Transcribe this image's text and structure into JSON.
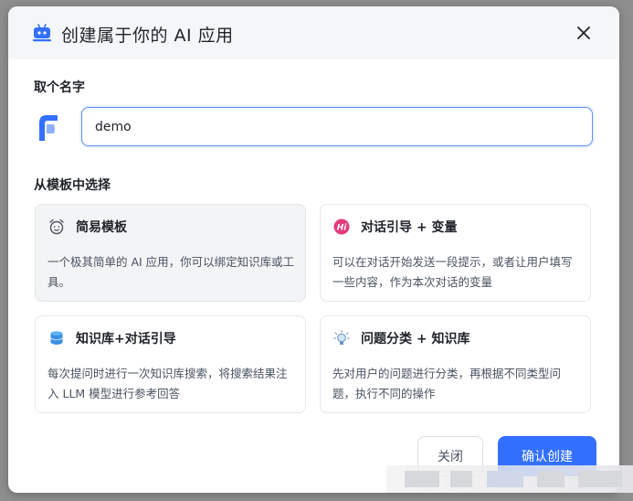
{
  "dialog": {
    "title": "创建属于你的 AI 应用",
    "name_section_label": "取个名字",
    "name_input_value": "demo",
    "template_section_label": "从模板中选择",
    "templates": [
      {
        "icon": "alarm-clock-icon",
        "title": "简易模板",
        "desc": "一个极其简单的 AI 应用，你可以绑定知识库或工具。",
        "selected": true
      },
      {
        "icon": "hi-badge-icon",
        "title": "对话引导 + 变量",
        "desc": "可以在对话开始发送一段提示，或者让用户填写一些内容，作为本次对话的变量",
        "selected": false
      },
      {
        "icon": "database-icon",
        "title": "知识库+对话引导",
        "desc": "每次提问时进行一次知识库搜索，将搜索结果注入 LLM 模型进行参考回答",
        "selected": false
      },
      {
        "icon": "lightbulb-icon",
        "title": "问题分类 + 知识库",
        "desc": "先对用户的问题进行分类，再根据不同类型问题，执行不同的操作",
        "selected": false
      }
    ],
    "cancel_label": "关闭",
    "confirm_label": "确认创建"
  },
  "colors": {
    "accent": "#3370ff",
    "header_bg": "#f5f6f8",
    "selected_card_bg": "#f3f4f6"
  }
}
